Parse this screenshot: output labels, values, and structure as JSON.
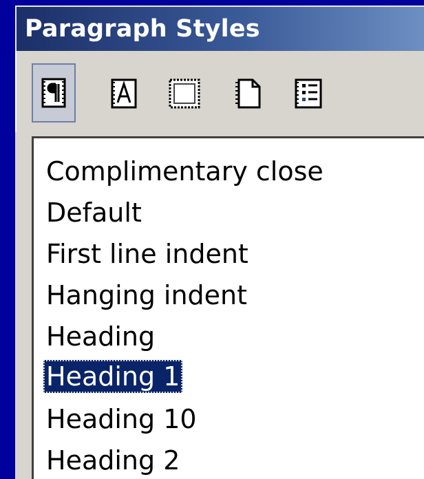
{
  "window": {
    "title": "Paragraph Styles"
  },
  "toolbar": {
    "buttons": [
      {
        "name": "paragraph-styles-icon",
        "icon": "pilcrow",
        "active": true
      },
      {
        "name": "character-styles-icon",
        "icon": "letter-A",
        "active": false
      },
      {
        "name": "frame-styles-icon",
        "icon": "frame",
        "active": false
      },
      {
        "name": "page-styles-icon",
        "icon": "page",
        "active": false
      },
      {
        "name": "list-styles-icon",
        "icon": "list",
        "active": false
      }
    ]
  },
  "styles_list": {
    "items": [
      "Complimentary close",
      "Default",
      "First line indent",
      "Hanging indent",
      "Heading",
      "Heading 1",
      "Heading 10",
      "Heading 2"
    ],
    "selected": "Heading 1"
  },
  "colors": {
    "background": "#00009c",
    "selection": "#0a246a",
    "titlebar_start": "#1b2f68",
    "titlebar_end": "#6d8fc2"
  }
}
